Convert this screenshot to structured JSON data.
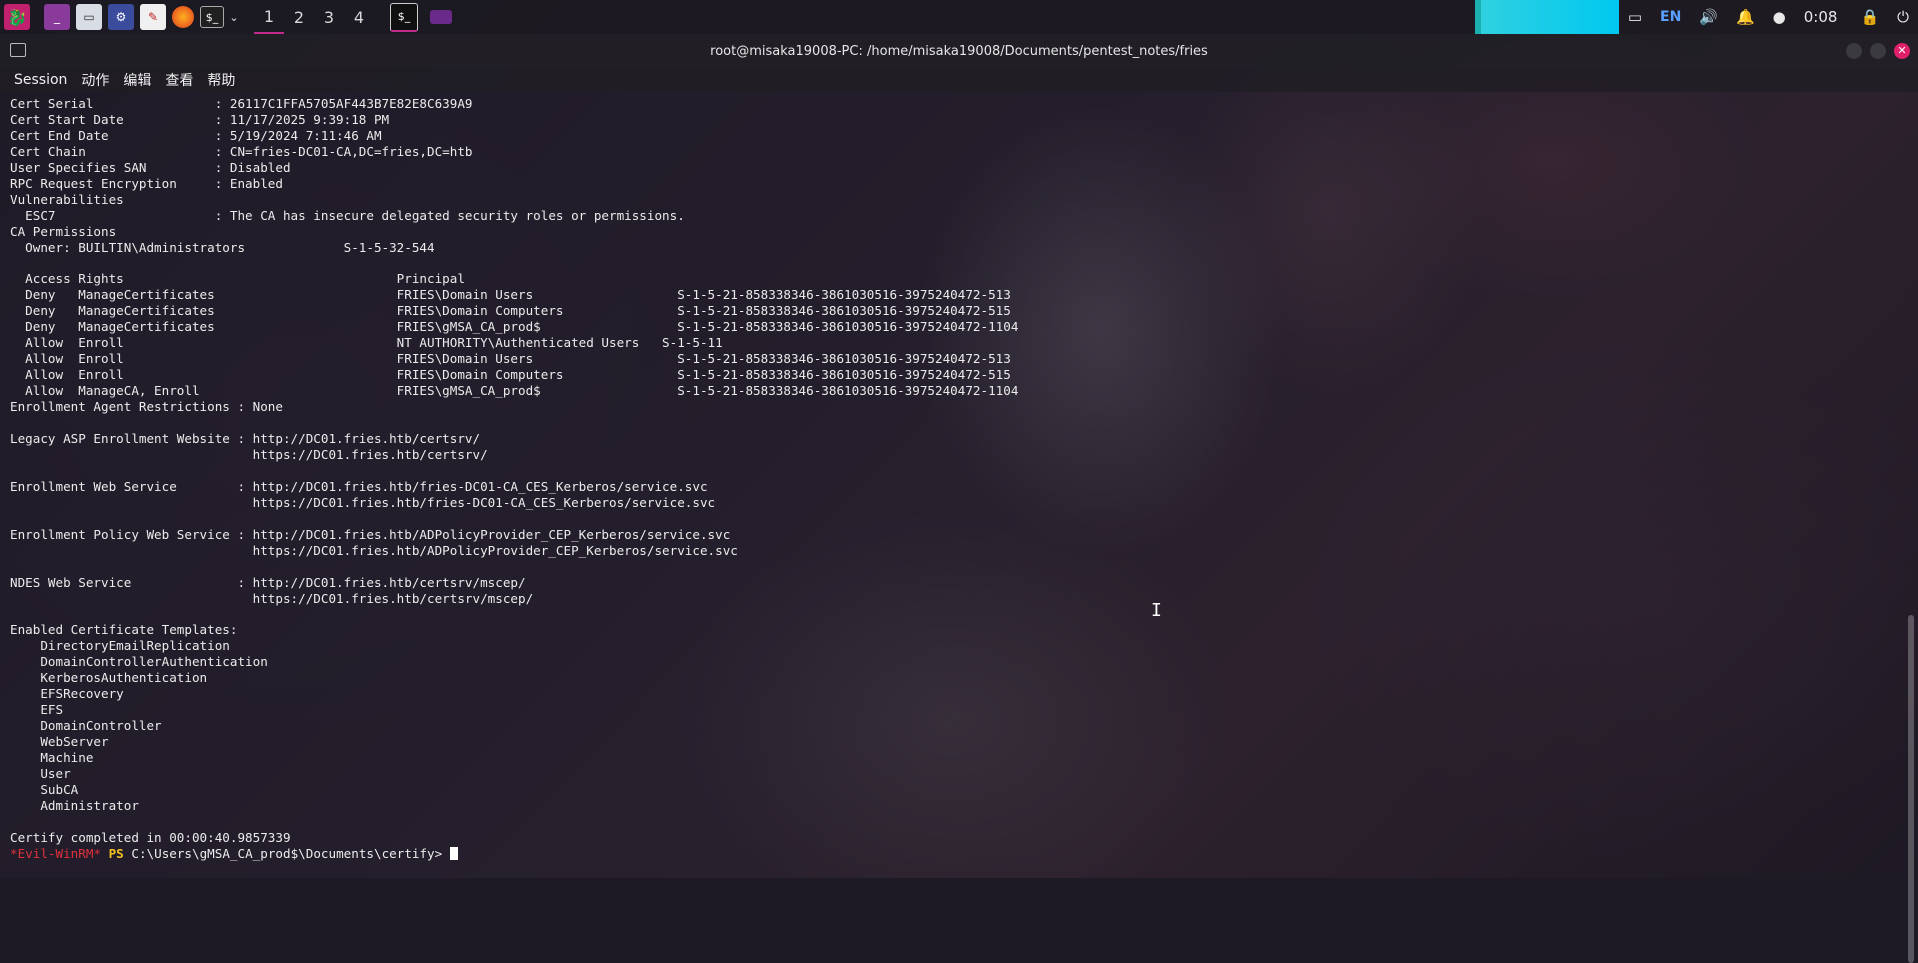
{
  "taskbar": {
    "workspaces": [
      "1",
      "2",
      "3",
      "4"
    ],
    "language": "EN",
    "clock": "0:08"
  },
  "window": {
    "title": "root@misaka19008-PC: /home/misaka19008/Documents/pentest_notes/fries"
  },
  "menu": [
    "Session",
    "动作",
    "编辑",
    "查看",
    "帮助"
  ],
  "terminal": {
    "lines": [
      "Cert Serial                : 26117C1FFA5705AF443B7E82E8C639A9",
      "Cert Start Date            : 11/17/2025 9:39:18 PM",
      "Cert End Date              : 5/19/2024 7:11:46 AM",
      "Cert Chain                 : CN=fries-DC01-CA,DC=fries,DC=htb",
      "User Specifies SAN         : Disabled",
      "RPC Request Encryption     : Enabled",
      "Vulnerabilities",
      "  ESC7                     : The CA has insecure delegated security roles or permissions.",
      "CA Permissions",
      "  Owner: BUILTIN\\Administrators             S-1-5-32-544",
      "",
      "  Access Rights                                    Principal",
      "  Deny   ManageCertificates                        FRIES\\Domain Users                   S-1-5-21-858338346-3861030516-3975240472-513",
      "  Deny   ManageCertificates                        FRIES\\Domain Computers               S-1-5-21-858338346-3861030516-3975240472-515",
      "  Deny   ManageCertificates                        FRIES\\gMSA_CA_prod$                  S-1-5-21-858338346-3861030516-3975240472-1104",
      "  Allow  Enroll                                    NT AUTHORITY\\Authenticated Users   S-1-5-11",
      "  Allow  Enroll                                    FRIES\\Domain Users                   S-1-5-21-858338346-3861030516-3975240472-513",
      "  Allow  Enroll                                    FRIES\\Domain Computers               S-1-5-21-858338346-3861030516-3975240472-515",
      "  Allow  ManageCA, Enroll                          FRIES\\gMSA_CA_prod$                  S-1-5-21-858338346-3861030516-3975240472-1104",
      "Enrollment Agent Restrictions : None",
      "",
      "Legacy ASP Enrollment Website : http://DC01.fries.htb/certsrv/",
      "                                https://DC01.fries.htb/certsrv/",
      "",
      "Enrollment Web Service        : http://DC01.fries.htb/fries-DC01-CA_CES_Kerberos/service.svc",
      "                                https://DC01.fries.htb/fries-DC01-CA_CES_Kerberos/service.svc",
      "",
      "Enrollment Policy Web Service : http://DC01.fries.htb/ADPolicyProvider_CEP_Kerberos/service.svc",
      "                                https://DC01.fries.htb/ADPolicyProvider_CEP_Kerberos/service.svc",
      "",
      "NDES Web Service              : http://DC01.fries.htb/certsrv/mscep/",
      "                                https://DC01.fries.htb/certsrv/mscep/",
      "",
      "Enabled Certificate Templates:",
      "    DirectoryEmailReplication",
      "    DomainControllerAuthentication",
      "    KerberosAuthentication",
      "    EFSRecovery",
      "    EFS",
      "    DomainController",
      "    WebServer",
      "    Machine",
      "    User",
      "    SubCA",
      "    Administrator",
      "",
      "Certify completed in 00:00:40.9857339"
    ],
    "prompt": {
      "shell": "*Evil-WinRM*",
      "ps": "PS",
      "path": "C:\\Users\\gMSA_CA_prod$\\Documents\\certify>"
    }
  }
}
